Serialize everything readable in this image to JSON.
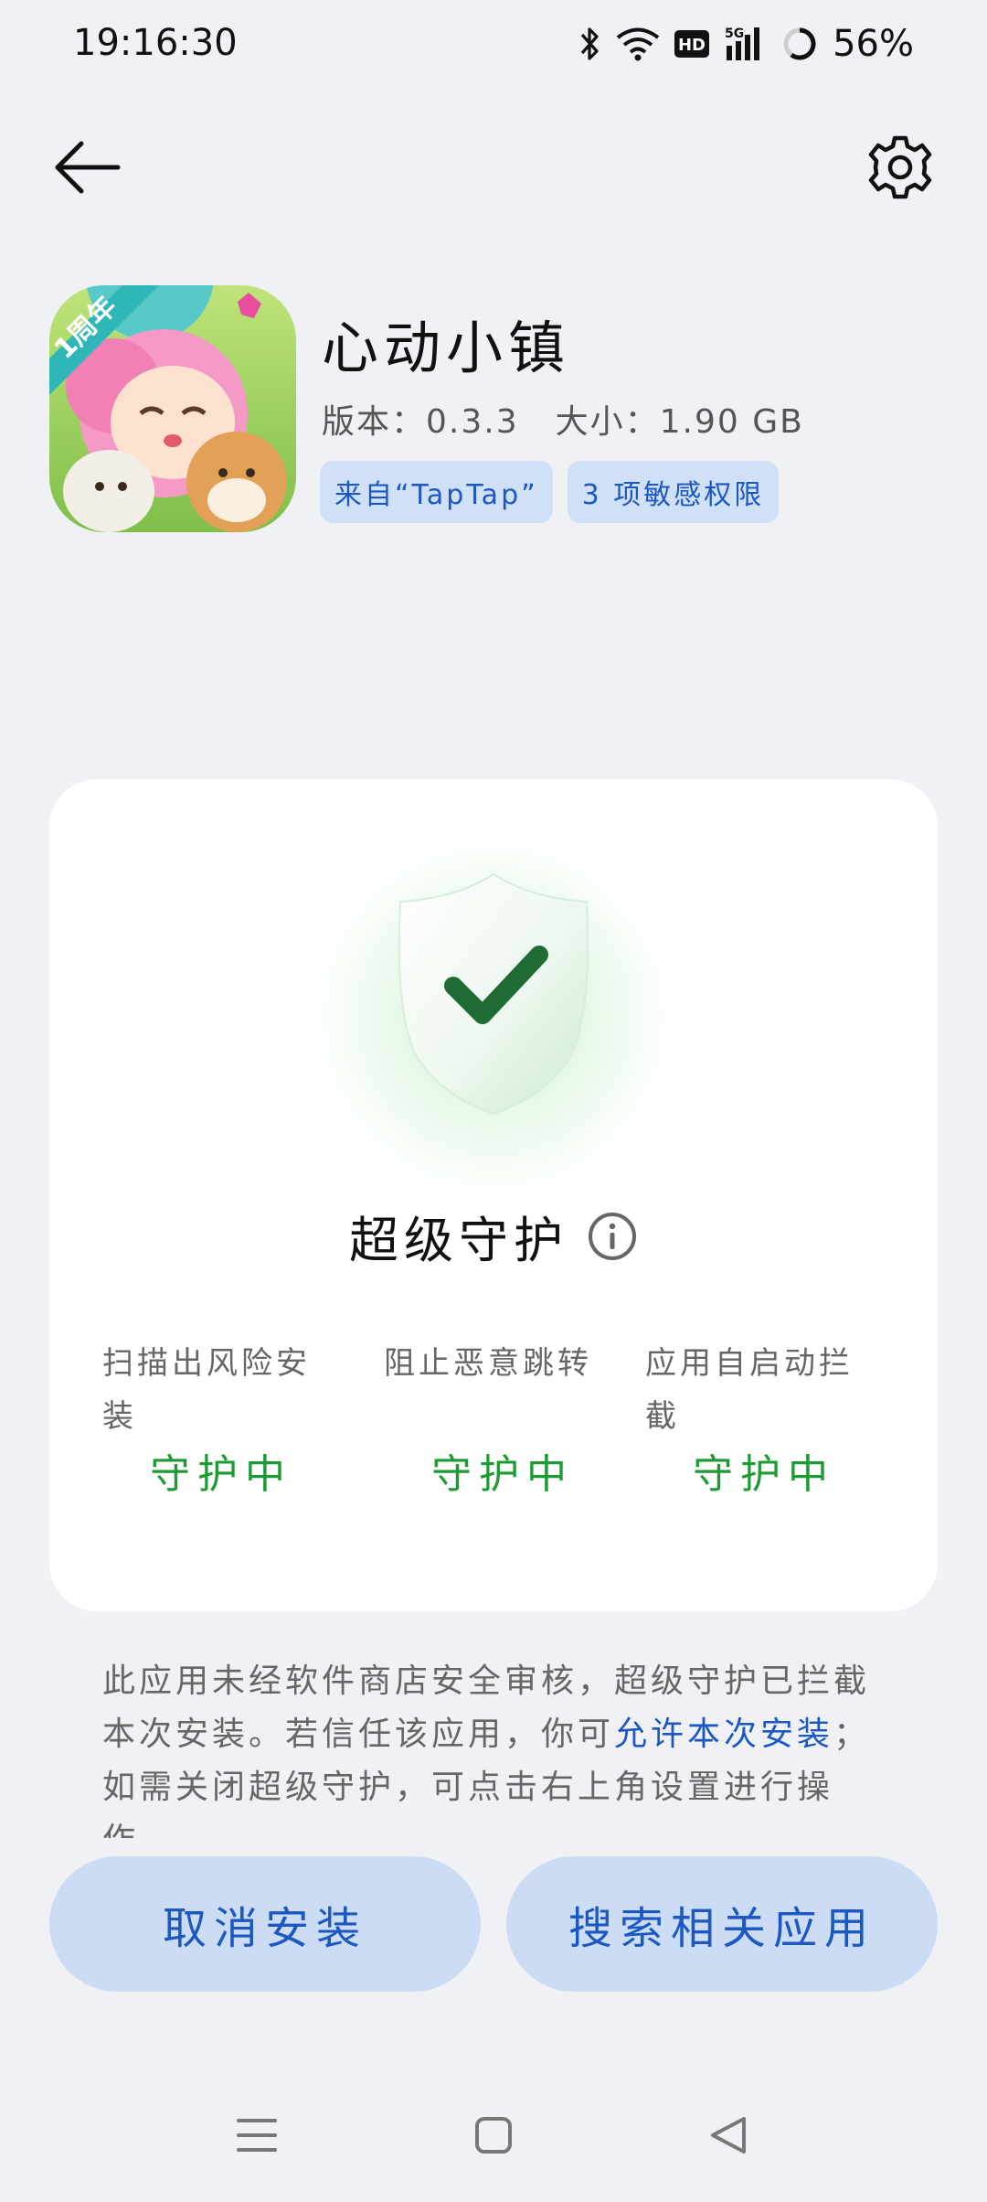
{
  "status_bar": {
    "time": "19:16:30",
    "battery": "56%",
    "icons": [
      "bluetooth-icon",
      "wifi-icon",
      "hd-icon",
      "5g-signal-icon",
      "battery-icon"
    ]
  },
  "app": {
    "name": "心动小镇",
    "version": "版本：0.3.3",
    "size": "大小：1.90 GB",
    "tags": [
      "来自“TapTap”",
      "3 项敏感权限"
    ],
    "icon_badge": "1周年"
  },
  "card": {
    "title": "超级守护",
    "features": [
      {
        "label": "扫描出风险安装",
        "status": "守护中"
      },
      {
        "label": "阻止恶意跳转",
        "status": "守护中"
      },
      {
        "label": "应用自启动拦截",
        "status": "守护中"
      }
    ]
  },
  "description": {
    "text_before": "此应用未经软件商店安全审核，超级守护已拦截本次安装。若信任该应用，你可",
    "link": "允许本次安装",
    "text_after": "；如需关闭超级守护，可点击右上角设置进行操作。"
  },
  "buttons": {
    "cancel": "取消安装",
    "search": "搜索相关应用"
  },
  "colors": {
    "accent": "#1c58c2",
    "green": "#1d9a33",
    "background": "#eff1f4",
    "tag_bg": "#cfe0f7"
  }
}
